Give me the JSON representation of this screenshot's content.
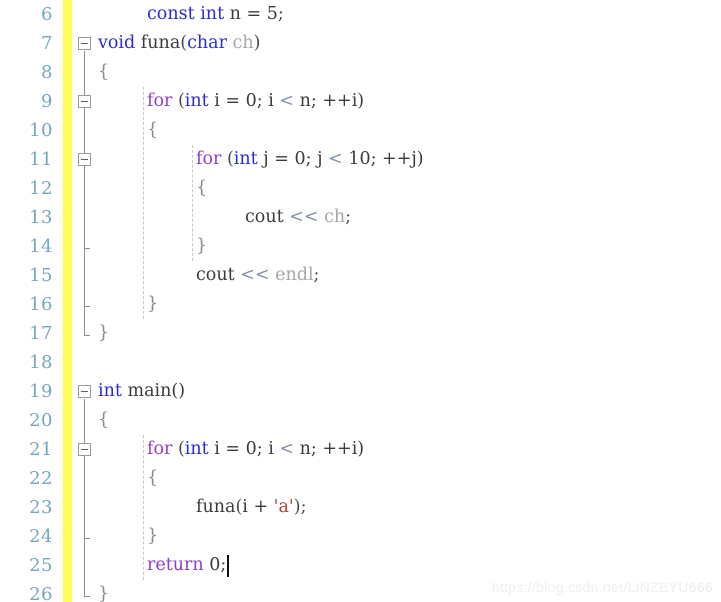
{
  "editor": {
    "first_line_number": 6,
    "line_height": 29,
    "gutter_width": 63,
    "change_bar_color": "#fdfd54",
    "line_number_color": "#74a8c0",
    "background_color": "#ffffff",
    "caret": {
      "line": 25,
      "after_text": "return 0;"
    }
  },
  "line_numbers": [
    6,
    7,
    8,
    9,
    10,
    11,
    12,
    13,
    14,
    15,
    16,
    17,
    18,
    19,
    20,
    21,
    22,
    23,
    24,
    25,
    26
  ],
  "fold_markers": [
    {
      "line": 7,
      "state": "expanded",
      "icon": "minus-box-icon"
    },
    {
      "line": 9,
      "state": "expanded",
      "icon": "minus-box-icon"
    },
    {
      "line": 11,
      "state": "expanded",
      "icon": "minus-box-icon"
    },
    {
      "line": 19,
      "state": "expanded",
      "icon": "minus-box-icon"
    },
    {
      "line": 21,
      "state": "expanded",
      "icon": "minus-box-icon"
    }
  ],
  "code_lines": [
    {
      "n": 6,
      "indent": 1,
      "text": "const int n = 5;",
      "tokens": [
        {
          "t": "const",
          "c": "kw"
        },
        {
          "t": " ",
          "c": "punc"
        },
        {
          "t": "int",
          "c": "kw"
        },
        {
          "t": " n = ",
          "c": "id"
        },
        {
          "t": "5",
          "c": "num"
        },
        {
          "t": ";",
          "c": "punc"
        }
      ]
    },
    {
      "n": 7,
      "indent": 0,
      "text": "void funa(char ch)",
      "tokens": [
        {
          "t": "void",
          "c": "kw"
        },
        {
          "t": " funa",
          "c": "id"
        },
        {
          "t": "(",
          "c": "punc"
        },
        {
          "t": "char",
          "c": "kw"
        },
        {
          "t": " ",
          "c": "punc"
        },
        {
          "t": "ch",
          "c": "dim"
        },
        {
          "t": ")",
          "c": "punc"
        }
      ]
    },
    {
      "n": 8,
      "indent": 0,
      "text": "{",
      "tokens": [
        {
          "t": "{",
          "c": "brace"
        }
      ]
    },
    {
      "n": 9,
      "indent": 1,
      "text": "for (int i = 0; i < n; ++i)",
      "tokens": [
        {
          "t": "for",
          "c": "ctl"
        },
        {
          "t": " (",
          "c": "punc"
        },
        {
          "t": "int",
          "c": "kw"
        },
        {
          "t": " i = ",
          "c": "id"
        },
        {
          "t": "0",
          "c": "num"
        },
        {
          "t": "; i ",
          "c": "id"
        },
        {
          "t": "<",
          "c": "op"
        },
        {
          "t": " n; ++i)",
          "c": "id"
        }
      ]
    },
    {
      "n": 10,
      "indent": 1,
      "text": "{",
      "tokens": [
        {
          "t": "{",
          "c": "brace"
        }
      ]
    },
    {
      "n": 11,
      "indent": 2,
      "text": "for (int j = 0; j < 10; ++j)",
      "tokens": [
        {
          "t": "for",
          "c": "ctl"
        },
        {
          "t": " (",
          "c": "punc"
        },
        {
          "t": "int",
          "c": "kw"
        },
        {
          "t": " j = ",
          "c": "id"
        },
        {
          "t": "0",
          "c": "num"
        },
        {
          "t": "; j ",
          "c": "id"
        },
        {
          "t": "<",
          "c": "op"
        },
        {
          "t": " ",
          "c": "id"
        },
        {
          "t": "10",
          "c": "num"
        },
        {
          "t": "; ++j)",
          "c": "id"
        }
      ]
    },
    {
      "n": 12,
      "indent": 2,
      "text": "{",
      "tokens": [
        {
          "t": "{",
          "c": "brace"
        }
      ]
    },
    {
      "n": 13,
      "indent": 3,
      "text": "cout << ch;",
      "tokens": [
        {
          "t": "cout ",
          "c": "id"
        },
        {
          "t": "<<",
          "c": "op"
        },
        {
          "t": " ",
          "c": "id"
        },
        {
          "t": "ch",
          "c": "dim"
        },
        {
          "t": ";",
          "c": "punc"
        }
      ]
    },
    {
      "n": 14,
      "indent": 2,
      "text": "}",
      "tokens": [
        {
          "t": "}",
          "c": "brace"
        }
      ]
    },
    {
      "n": 15,
      "indent": 2,
      "text": "cout << endl;",
      "tokens": [
        {
          "t": "cout ",
          "c": "id"
        },
        {
          "t": "<<",
          "c": "op"
        },
        {
          "t": " ",
          "c": "id"
        },
        {
          "t": "endl",
          "c": "dim"
        },
        {
          "t": ";",
          "c": "punc"
        }
      ]
    },
    {
      "n": 16,
      "indent": 1,
      "text": "}",
      "tokens": [
        {
          "t": "}",
          "c": "brace"
        }
      ]
    },
    {
      "n": 17,
      "indent": 0,
      "text": "}",
      "tokens": [
        {
          "t": "}",
          "c": "brace"
        }
      ]
    },
    {
      "n": 18,
      "indent": 0,
      "text": "",
      "tokens": []
    },
    {
      "n": 19,
      "indent": 0,
      "text": "int main()",
      "tokens": [
        {
          "t": "int",
          "c": "kw"
        },
        {
          "t": " main()",
          "c": "id"
        }
      ]
    },
    {
      "n": 20,
      "indent": 0,
      "text": "{",
      "tokens": [
        {
          "t": "{",
          "c": "brace"
        }
      ]
    },
    {
      "n": 21,
      "indent": 1,
      "text": "for (int i = 0; i < n; ++i)",
      "tokens": [
        {
          "t": "for",
          "c": "ctl"
        },
        {
          "t": " (",
          "c": "punc"
        },
        {
          "t": "int",
          "c": "kw"
        },
        {
          "t": " i = ",
          "c": "id"
        },
        {
          "t": "0",
          "c": "num"
        },
        {
          "t": "; i ",
          "c": "id"
        },
        {
          "t": "<",
          "c": "op"
        },
        {
          "t": " n; ++i)",
          "c": "id"
        }
      ]
    },
    {
      "n": 22,
      "indent": 1,
      "text": "{",
      "tokens": [
        {
          "t": "{",
          "c": "brace"
        }
      ]
    },
    {
      "n": 23,
      "indent": 2,
      "text": "funa(i + 'a');",
      "tokens": [
        {
          "t": "funa",
          "c": "id"
        },
        {
          "t": "(",
          "c": "punc"
        },
        {
          "t": "i + ",
          "c": "id"
        },
        {
          "t": "'a'",
          "c": "str"
        },
        {
          "t": ")",
          "c": "punc"
        },
        {
          "t": ";",
          "c": "punc"
        }
      ]
    },
    {
      "n": 24,
      "indent": 1,
      "text": "}",
      "tokens": [
        {
          "t": "}",
          "c": "brace"
        }
      ]
    },
    {
      "n": 25,
      "indent": 1,
      "text": "return 0;",
      "tokens": [
        {
          "t": "return",
          "c": "ctl"
        },
        {
          "t": " ",
          "c": "id"
        },
        {
          "t": "0",
          "c": "num"
        },
        {
          "t": ";",
          "c": "punc"
        }
      ]
    },
    {
      "n": 26,
      "indent": 0,
      "text": "}",
      "tokens": [
        {
          "t": "}",
          "c": "brace"
        }
      ]
    }
  ],
  "fold_lines": [
    {
      "from_line": 7,
      "to_line": 17,
      "has_end_tick": true
    },
    {
      "from_line": 9,
      "to_line": 16,
      "has_end_tick": true
    },
    {
      "from_line": 11,
      "to_line": 14,
      "has_end_tick": true
    },
    {
      "from_line": 19,
      "to_line": 26,
      "has_end_tick": true
    },
    {
      "from_line": 21,
      "to_line": 24,
      "has_end_tick": true
    }
  ],
  "indent_guides": [
    {
      "indent": 1,
      "from_line": 9,
      "to_line": 16
    },
    {
      "indent": 2,
      "from_line": 11,
      "to_line": 14
    },
    {
      "indent": 1,
      "from_line": 21,
      "to_line": 25
    }
  ],
  "watermark": {
    "text": "https://blog.csdn.net/LINZEYU666"
  }
}
